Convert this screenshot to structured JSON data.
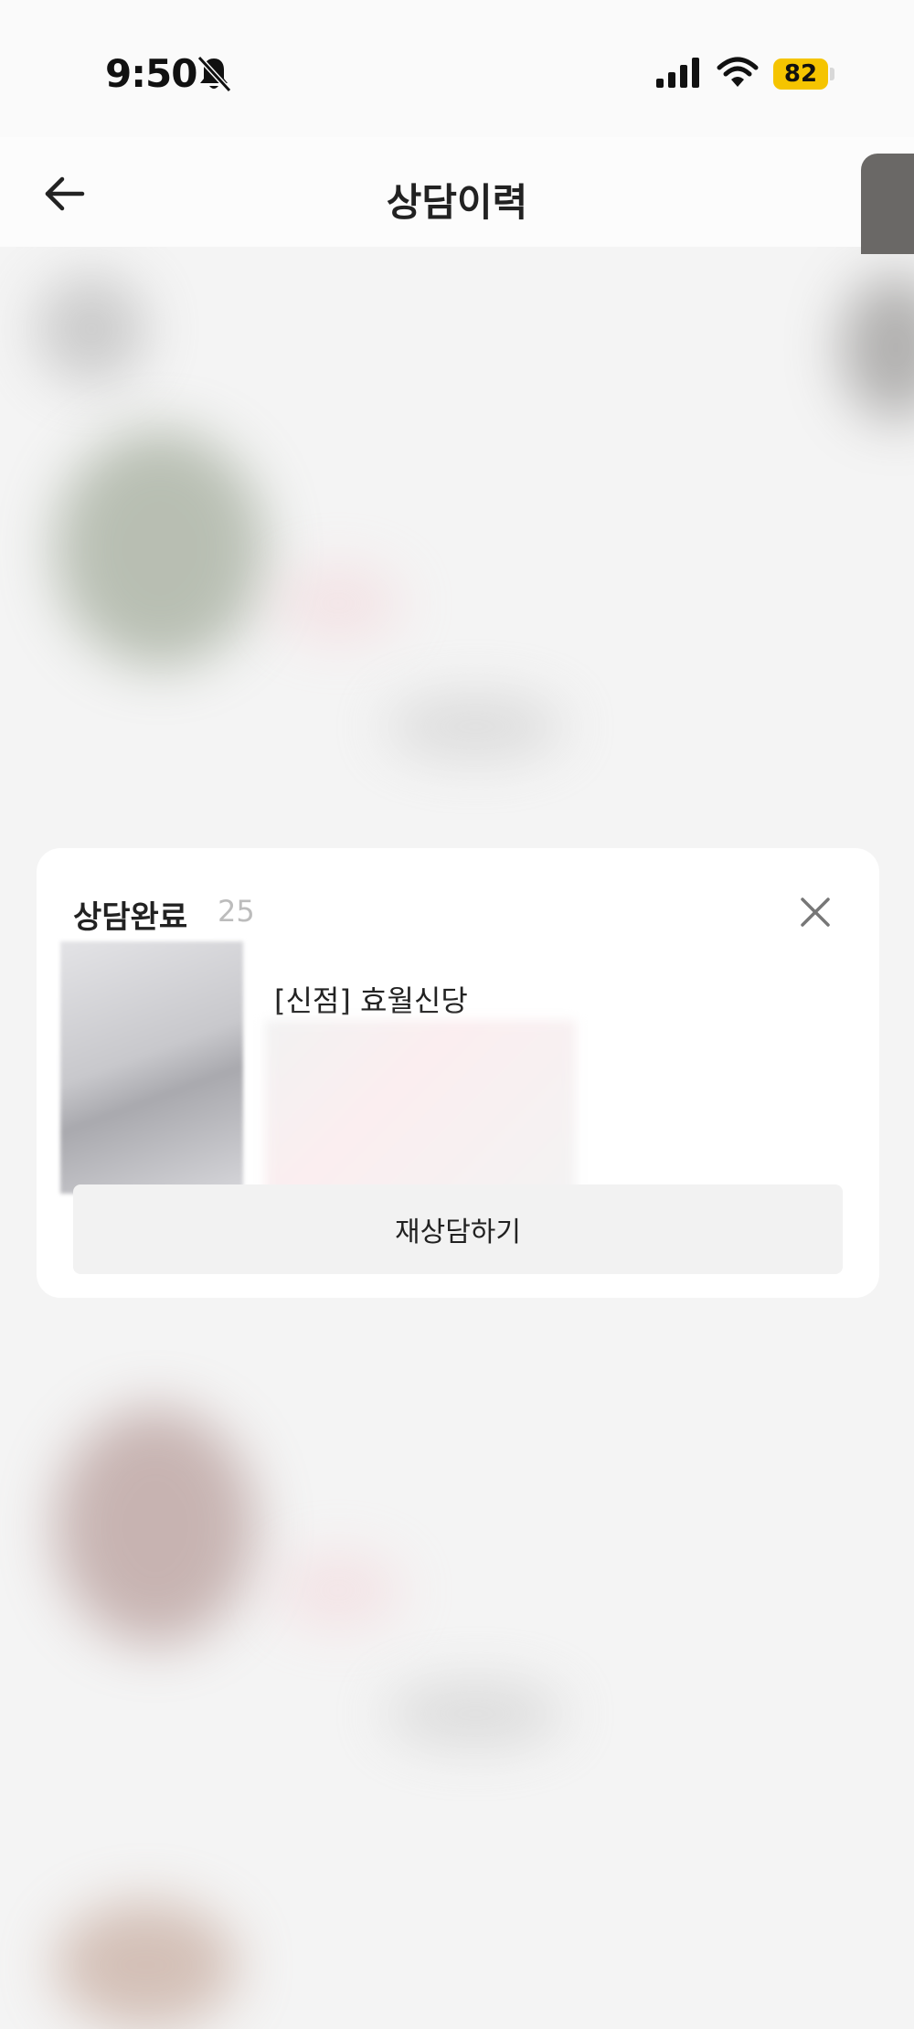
{
  "status_bar": {
    "time": "9:50",
    "battery": "82",
    "icons": [
      "bell-slash-icon",
      "cellular-signal-icon",
      "wifi-icon",
      "battery-icon"
    ]
  },
  "header": {
    "title": "상담이력",
    "back_icon": "arrow-left-icon"
  },
  "card": {
    "status": "상담완료",
    "date": "25.",
    "store_name": "[신점] 효월신당",
    "close_icon": "close-x-icon",
    "button_label": "재상담하기"
  },
  "colors": {
    "battery_badge": "#f5c400",
    "card_background": "#ffffff",
    "button_background": "#f2f2f2"
  }
}
